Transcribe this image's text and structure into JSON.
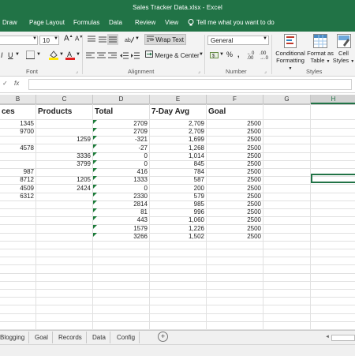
{
  "window": {
    "title": "Sales Tracker Data.xlsx  -  Excel"
  },
  "ribbon_tabs": [
    "Draw",
    "Page Layout",
    "Formulas",
    "Data",
    "Review",
    "View"
  ],
  "tell_me": "Tell me what you want to do",
  "font": {
    "size": "10"
  },
  "alignment": {
    "wrap_text": "Wrap Text",
    "merge_center": "Merge & Center"
  },
  "number": {
    "format": "General"
  },
  "styles": {
    "conditional_formatting": "Conditional Formatting",
    "format_as_table": "Format as Table",
    "cell_styles": "Cell Styles"
  },
  "group_labels": {
    "font": "Font",
    "alignment": "Alignment",
    "number": "Number",
    "styles": "Styles"
  },
  "formula_bar": {
    "fx": "fx",
    "value": ""
  },
  "columns": [
    "B",
    "C",
    "D",
    "E",
    "F",
    "G",
    "H"
  ],
  "selected_column": "H",
  "headers": {
    "B": "ces",
    "C": "Products",
    "D": "Total",
    "E": "7-Day Avg",
    "F": "Goal"
  },
  "rows": [
    {
      "B": "1345",
      "C": "",
      "D": "2709",
      "E": "2,709",
      "F": "2500"
    },
    {
      "B": "9700",
      "C": "",
      "D": "2709",
      "E": "2,709",
      "F": "2500"
    },
    {
      "B": "",
      "C": "1259",
      "D": "-321",
      "E": "1,699",
      "F": "2500"
    },
    {
      "B": "4578",
      "C": "",
      "D": "-27",
      "E": "1,268",
      "F": "2500"
    },
    {
      "B": "",
      "C": "3336",
      "D": "0",
      "E": "1,014",
      "F": "2500"
    },
    {
      "B": "",
      "C": "3799",
      "D": "0",
      "E": "845",
      "F": "2500"
    },
    {
      "B": "987",
      "C": "",
      "D": "416",
      "E": "784",
      "F": "2500"
    },
    {
      "B": "8712",
      "C": "1205",
      "D": "1333",
      "E": "587",
      "F": "2500"
    },
    {
      "B": "4509",
      "C": "2424",
      "D": "0",
      "E": "200",
      "F": "2500"
    },
    {
      "B": "6312",
      "C": "",
      "D": "2330",
      "E": "579",
      "F": "2500"
    },
    {
      "B": "",
      "C": "",
      "D": "2814",
      "E": "985",
      "F": "2500"
    },
    {
      "B": "",
      "C": "",
      "D": "81",
      "E": "996",
      "F": "2500"
    },
    {
      "B": "",
      "C": "",
      "D": "443",
      "E": "1,060",
      "F": "2500"
    },
    {
      "B": "",
      "C": "",
      "D": "1579",
      "E": "1,226",
      "F": "2500"
    },
    {
      "B": "",
      "C": "",
      "D": "3266",
      "E": "1,502",
      "F": "2500"
    }
  ],
  "sheet_tabs": [
    "Blogging",
    "Goal",
    "Records",
    "Data",
    "Config"
  ]
}
